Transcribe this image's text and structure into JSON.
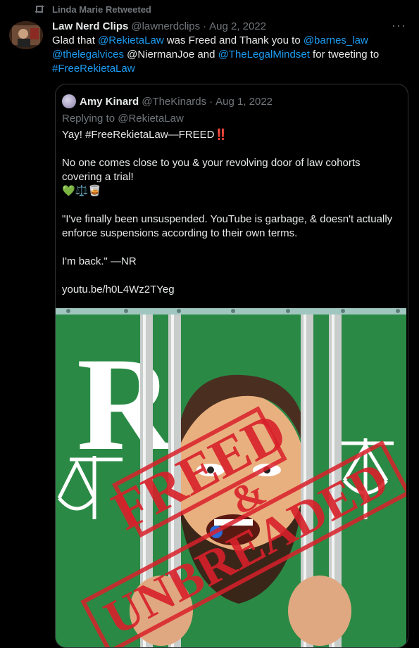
{
  "retweet": {
    "text": "Linda Marie Retweeted"
  },
  "tweet": {
    "name": "Law Nerd Clips",
    "handle": "@lawnerdclips",
    "separator": "·",
    "date": "Aug 2, 2022",
    "more": "···",
    "text": {
      "p1": "Glad that ",
      "m1": "@RekietaLaw",
      "p2": " was Freed and Thank you to ",
      "m2": "@barnes_law",
      "m3": "@thelegalvices",
      "p3": " @NiermanJoe and ",
      "m4": "@TheLegalMindset",
      "p4": " for tweeting to",
      "hashtag": "#FreeRekietaLaw"
    }
  },
  "quote": {
    "name": "Amy Kinard",
    "handle": "@TheKinards",
    "separator": "·",
    "date": "Aug 1, 2022",
    "replying": "Replying to @RekietaLaw",
    "lines": {
      "l1": "Yay! #FreeRekietaLaw—FREED",
      "l1_emoji": "‼️",
      "l2": "No one comes close to you & your revolving door of law cohorts covering a trial!",
      "l3": "💚⚖️🥃",
      "l4": "\"I've finally been unsuspended. YouTube is garbage, & doesn't actually enforce suspensions according to their own terms.",
      "l5": "I'm back.\" —NR",
      "l6": "youtu.be/h0L4Wz2TYeg"
    },
    "image": {
      "letter": "R",
      "stamp1": "FREED",
      "stamp2": "&",
      "stamp3": "UNBREADED"
    }
  },
  "colors": {
    "background": "#000000",
    "link": "#1d9bf0",
    "muted": "#71767b",
    "image_green": "#2a8a45",
    "stamp_red": "#d8202a"
  }
}
